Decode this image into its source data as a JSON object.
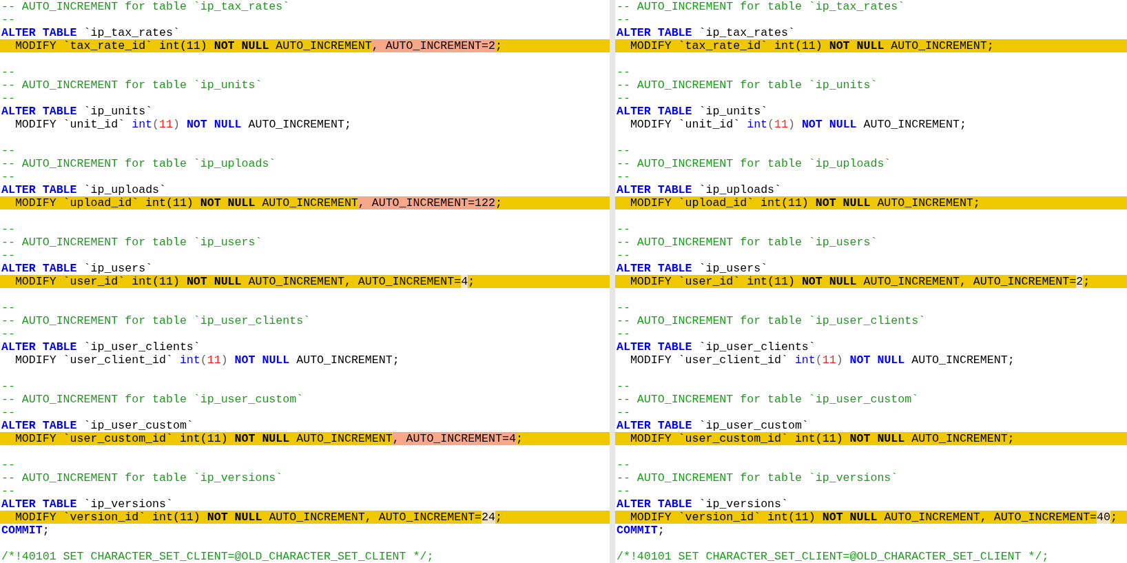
{
  "left": {
    "lines": [
      {
        "kind": "code",
        "changed": false,
        "segments": [
          {
            "kind": "comment",
            "text": "-- AUTO_INCREMENT for table `ip_tax_rates`"
          }
        ]
      },
      {
        "kind": "code",
        "changed": false,
        "segments": [
          {
            "kind": "comment",
            "text": "--"
          }
        ]
      },
      {
        "kind": "code",
        "changed": false,
        "segments": [
          {
            "kind": "keyword",
            "text": "ALTER TABLE"
          },
          {
            "kind": "plain",
            "text": " `ip_tax_rates`"
          }
        ]
      },
      {
        "kind": "code",
        "changed": true,
        "segments": [
          {
            "kind": "plain",
            "text": "  MODIFY `tax_rate_id` int(11) "
          },
          {
            "kind": "strong",
            "text": "NOT NULL"
          },
          {
            "kind": "plain",
            "text": " AUTO_INCREMENT"
          },
          {
            "kind": "plain",
            "text": ", AUTO_INCREMENT=2",
            "removed": true
          },
          {
            "kind": "plain",
            "text": ";"
          }
        ]
      },
      {
        "kind": "blank"
      },
      {
        "kind": "code",
        "changed": false,
        "segments": [
          {
            "kind": "comment",
            "text": "--"
          }
        ]
      },
      {
        "kind": "code",
        "changed": false,
        "segments": [
          {
            "kind": "comment",
            "text": "-- AUTO_INCREMENT for table `ip_units`"
          }
        ]
      },
      {
        "kind": "code",
        "changed": false,
        "segments": [
          {
            "kind": "comment",
            "text": "--"
          }
        ]
      },
      {
        "kind": "code",
        "changed": false,
        "segments": [
          {
            "kind": "keyword",
            "text": "ALTER TABLE"
          },
          {
            "kind": "plain",
            "text": " `ip_units`"
          }
        ]
      },
      {
        "kind": "code",
        "changed": false,
        "segments": [
          {
            "kind": "plain",
            "text": "  MODIFY `unit_id` "
          },
          {
            "kind": "type",
            "text": "int"
          },
          {
            "kind": "punct",
            "text": "("
          },
          {
            "kind": "number",
            "text": "11"
          },
          {
            "kind": "punct",
            "text": ") "
          },
          {
            "kind": "keyword",
            "text": "NOT NULL"
          },
          {
            "kind": "plain",
            "text": " AUTO_INCREMENT;"
          }
        ]
      },
      {
        "kind": "blank"
      },
      {
        "kind": "code",
        "changed": false,
        "segments": [
          {
            "kind": "comment",
            "text": "--"
          }
        ]
      },
      {
        "kind": "code",
        "changed": false,
        "segments": [
          {
            "kind": "comment",
            "text": "-- AUTO_INCREMENT for table `ip_uploads`"
          }
        ]
      },
      {
        "kind": "code",
        "changed": false,
        "segments": [
          {
            "kind": "comment",
            "text": "--"
          }
        ]
      },
      {
        "kind": "code",
        "changed": false,
        "segments": [
          {
            "kind": "keyword",
            "text": "ALTER TABLE"
          },
          {
            "kind": "plain",
            "text": " `ip_uploads`"
          }
        ]
      },
      {
        "kind": "code",
        "changed": true,
        "segments": [
          {
            "kind": "plain",
            "text": "  MODIFY `upload_id` int(11) "
          },
          {
            "kind": "strong",
            "text": "NOT NULL"
          },
          {
            "kind": "plain",
            "text": " AUTO_INCREMENT"
          },
          {
            "kind": "plain",
            "text": ", AUTO_INCREMENT=122",
            "removed": true
          },
          {
            "kind": "plain",
            "text": ";"
          }
        ]
      },
      {
        "kind": "blank"
      },
      {
        "kind": "code",
        "changed": false,
        "segments": [
          {
            "kind": "comment",
            "text": "--"
          }
        ]
      },
      {
        "kind": "code",
        "changed": false,
        "segments": [
          {
            "kind": "comment",
            "text": "-- AUTO_INCREMENT for table `ip_users`"
          }
        ]
      },
      {
        "kind": "code",
        "changed": false,
        "segments": [
          {
            "kind": "comment",
            "text": "--"
          }
        ]
      },
      {
        "kind": "code",
        "changed": false,
        "segments": [
          {
            "kind": "keyword",
            "text": "ALTER TABLE"
          },
          {
            "kind": "plain",
            "text": " `ip_users`"
          }
        ]
      },
      {
        "kind": "code",
        "changed": true,
        "segments": [
          {
            "kind": "plain",
            "text": "  MODIFY `user_id` int(11) "
          },
          {
            "kind": "strong",
            "text": "NOT NULL"
          },
          {
            "kind": "plain",
            "text": " AUTO_INCREMENT, AUTO_INCREMENT="
          },
          {
            "kind": "plain",
            "text": "4",
            "modified": true
          },
          {
            "kind": "plain",
            "text": ";"
          }
        ]
      },
      {
        "kind": "blank"
      },
      {
        "kind": "code",
        "changed": false,
        "segments": [
          {
            "kind": "comment",
            "text": "--"
          }
        ]
      },
      {
        "kind": "code",
        "changed": false,
        "segments": [
          {
            "kind": "comment",
            "text": "-- AUTO_INCREMENT for table `ip_user_clients`"
          }
        ]
      },
      {
        "kind": "code",
        "changed": false,
        "segments": [
          {
            "kind": "comment",
            "text": "--"
          }
        ]
      },
      {
        "kind": "code",
        "changed": false,
        "segments": [
          {
            "kind": "keyword",
            "text": "ALTER TABLE"
          },
          {
            "kind": "plain",
            "text": " `ip_user_clients`"
          }
        ]
      },
      {
        "kind": "code",
        "changed": false,
        "segments": [
          {
            "kind": "plain",
            "text": "  MODIFY `user_client_id` "
          },
          {
            "kind": "type",
            "text": "int"
          },
          {
            "kind": "punct",
            "text": "("
          },
          {
            "kind": "number",
            "text": "11"
          },
          {
            "kind": "punct",
            "text": ") "
          },
          {
            "kind": "keyword",
            "text": "NOT NULL"
          },
          {
            "kind": "plain",
            "text": " AUTO_INCREMENT;"
          }
        ]
      },
      {
        "kind": "blank"
      },
      {
        "kind": "code",
        "changed": false,
        "segments": [
          {
            "kind": "comment",
            "text": "--"
          }
        ]
      },
      {
        "kind": "code",
        "changed": false,
        "segments": [
          {
            "kind": "comment",
            "text": "-- AUTO_INCREMENT for table `ip_user_custom`"
          }
        ]
      },
      {
        "kind": "code",
        "changed": false,
        "segments": [
          {
            "kind": "comment",
            "text": "--"
          }
        ]
      },
      {
        "kind": "code",
        "changed": false,
        "segments": [
          {
            "kind": "keyword",
            "text": "ALTER TABLE"
          },
          {
            "kind": "plain",
            "text": " `ip_user_custom`"
          }
        ]
      },
      {
        "kind": "code",
        "changed": true,
        "segments": [
          {
            "kind": "plain",
            "text": "  MODIFY `user_custom_id` int(11) "
          },
          {
            "kind": "strong",
            "text": "NOT NULL"
          },
          {
            "kind": "plain",
            "text": " AUTO_INCREMENT"
          },
          {
            "kind": "plain",
            "text": ", AUTO_INCREMENT=4",
            "removed": true
          },
          {
            "kind": "plain",
            "text": ";"
          }
        ]
      },
      {
        "kind": "blank"
      },
      {
        "kind": "code",
        "changed": false,
        "segments": [
          {
            "kind": "comment",
            "text": "--"
          }
        ]
      },
      {
        "kind": "code",
        "changed": false,
        "segments": [
          {
            "kind": "comment",
            "text": "-- AUTO_INCREMENT for table `ip_versions`"
          }
        ]
      },
      {
        "kind": "code",
        "changed": false,
        "segments": [
          {
            "kind": "comment",
            "text": "--"
          }
        ]
      },
      {
        "kind": "code",
        "changed": false,
        "segments": [
          {
            "kind": "keyword",
            "text": "ALTER TABLE"
          },
          {
            "kind": "plain",
            "text": " `ip_versions`"
          }
        ]
      },
      {
        "kind": "code",
        "changed": true,
        "segments": [
          {
            "kind": "plain",
            "text": "  MODIFY `version_id` int(11) "
          },
          {
            "kind": "strong",
            "text": "NOT NULL"
          },
          {
            "kind": "plain",
            "text": " AUTO_INCREMENT, AUTO_INCREMENT="
          },
          {
            "kind": "plain",
            "text": "24",
            "modified": true
          },
          {
            "kind": "plain",
            "text": ";"
          }
        ]
      },
      {
        "kind": "code",
        "changed": false,
        "segments": [
          {
            "kind": "keyword",
            "text": "COMMIT"
          },
          {
            "kind": "plain",
            "text": ";"
          }
        ]
      },
      {
        "kind": "blank"
      },
      {
        "kind": "code",
        "changed": false,
        "segments": [
          {
            "kind": "comment",
            "text": "/*!40101 SET CHARACTER_SET_CLIENT=@OLD_CHARACTER_SET_CLIENT */;"
          }
        ]
      }
    ]
  },
  "right": {
    "lines": [
      {
        "kind": "code",
        "changed": false,
        "segments": [
          {
            "kind": "comment",
            "text": "-- AUTO_INCREMENT for table `ip_tax_rates`"
          }
        ]
      },
      {
        "kind": "code",
        "changed": false,
        "segments": [
          {
            "kind": "comment",
            "text": "--"
          }
        ]
      },
      {
        "kind": "code",
        "changed": false,
        "segments": [
          {
            "kind": "keyword",
            "text": "ALTER TABLE"
          },
          {
            "kind": "plain",
            "text": " `ip_tax_rates`"
          }
        ]
      },
      {
        "kind": "code",
        "changed": true,
        "segments": [
          {
            "kind": "plain",
            "text": "  MODIFY `tax_rate_id` int(11) "
          },
          {
            "kind": "strong",
            "text": "NOT NULL"
          },
          {
            "kind": "plain",
            "text": " AUTO_INCREMENT;"
          }
        ]
      },
      {
        "kind": "blank"
      },
      {
        "kind": "code",
        "changed": false,
        "segments": [
          {
            "kind": "comment",
            "text": "--"
          }
        ]
      },
      {
        "kind": "code",
        "changed": false,
        "segments": [
          {
            "kind": "comment",
            "text": "-- AUTO_INCREMENT for table `ip_units`"
          }
        ]
      },
      {
        "kind": "code",
        "changed": false,
        "segments": [
          {
            "kind": "comment",
            "text": "--"
          }
        ]
      },
      {
        "kind": "code",
        "changed": false,
        "segments": [
          {
            "kind": "keyword",
            "text": "ALTER TABLE"
          },
          {
            "kind": "plain",
            "text": " `ip_units`"
          }
        ]
      },
      {
        "kind": "code",
        "changed": false,
        "segments": [
          {
            "kind": "plain",
            "text": "  MODIFY `unit_id` "
          },
          {
            "kind": "type",
            "text": "int"
          },
          {
            "kind": "punct",
            "text": "("
          },
          {
            "kind": "number",
            "text": "11"
          },
          {
            "kind": "punct",
            "text": ") "
          },
          {
            "kind": "keyword",
            "text": "NOT NULL"
          },
          {
            "kind": "plain",
            "text": " AUTO_INCREMENT;"
          }
        ]
      },
      {
        "kind": "blank"
      },
      {
        "kind": "code",
        "changed": false,
        "segments": [
          {
            "kind": "comment",
            "text": "--"
          }
        ]
      },
      {
        "kind": "code",
        "changed": false,
        "segments": [
          {
            "kind": "comment",
            "text": "-- AUTO_INCREMENT for table `ip_uploads`"
          }
        ]
      },
      {
        "kind": "code",
        "changed": false,
        "segments": [
          {
            "kind": "comment",
            "text": "--"
          }
        ]
      },
      {
        "kind": "code",
        "changed": false,
        "segments": [
          {
            "kind": "keyword",
            "text": "ALTER TABLE"
          },
          {
            "kind": "plain",
            "text": " `ip_uploads`"
          }
        ]
      },
      {
        "kind": "code",
        "changed": true,
        "segments": [
          {
            "kind": "plain",
            "text": "  MODIFY `upload_id` int(11) "
          },
          {
            "kind": "strong",
            "text": "NOT NULL"
          },
          {
            "kind": "plain",
            "text": " AUTO_INCREMENT;"
          }
        ]
      },
      {
        "kind": "blank"
      },
      {
        "kind": "code",
        "changed": false,
        "segments": [
          {
            "kind": "comment",
            "text": "--"
          }
        ]
      },
      {
        "kind": "code",
        "changed": false,
        "segments": [
          {
            "kind": "comment",
            "text": "-- AUTO_INCREMENT for table `ip_users`"
          }
        ]
      },
      {
        "kind": "code",
        "changed": false,
        "segments": [
          {
            "kind": "comment",
            "text": "--"
          }
        ]
      },
      {
        "kind": "code",
        "changed": false,
        "segments": [
          {
            "kind": "keyword",
            "text": "ALTER TABLE"
          },
          {
            "kind": "plain",
            "text": " `ip_users`"
          }
        ]
      },
      {
        "kind": "code",
        "changed": true,
        "segments": [
          {
            "kind": "plain",
            "text": "  MODIFY `user_id` int(11) "
          },
          {
            "kind": "strong",
            "text": "NOT NULL"
          },
          {
            "kind": "plain",
            "text": " AUTO_INCREMENT, AUTO_INCREMENT="
          },
          {
            "kind": "plain",
            "text": "2",
            "modified": true
          },
          {
            "kind": "plain",
            "text": ";"
          }
        ]
      },
      {
        "kind": "blank"
      },
      {
        "kind": "code",
        "changed": false,
        "segments": [
          {
            "kind": "comment",
            "text": "--"
          }
        ]
      },
      {
        "kind": "code",
        "changed": false,
        "segments": [
          {
            "kind": "comment",
            "text": "-- AUTO_INCREMENT for table `ip_user_clients`"
          }
        ]
      },
      {
        "kind": "code",
        "changed": false,
        "segments": [
          {
            "kind": "comment",
            "text": "--"
          }
        ]
      },
      {
        "kind": "code",
        "changed": false,
        "segments": [
          {
            "kind": "keyword",
            "text": "ALTER TABLE"
          },
          {
            "kind": "plain",
            "text": " `ip_user_clients`"
          }
        ]
      },
      {
        "kind": "code",
        "changed": false,
        "segments": [
          {
            "kind": "plain",
            "text": "  MODIFY `user_client_id` "
          },
          {
            "kind": "type",
            "text": "int"
          },
          {
            "kind": "punct",
            "text": "("
          },
          {
            "kind": "number",
            "text": "11"
          },
          {
            "kind": "punct",
            "text": ") "
          },
          {
            "kind": "keyword",
            "text": "NOT NULL"
          },
          {
            "kind": "plain",
            "text": " AUTO_INCREMENT;"
          }
        ]
      },
      {
        "kind": "blank"
      },
      {
        "kind": "code",
        "changed": false,
        "segments": [
          {
            "kind": "comment",
            "text": "--"
          }
        ]
      },
      {
        "kind": "code",
        "changed": false,
        "segments": [
          {
            "kind": "comment",
            "text": "-- AUTO_INCREMENT for table `ip_user_custom`"
          }
        ]
      },
      {
        "kind": "code",
        "changed": false,
        "segments": [
          {
            "kind": "comment",
            "text": "--"
          }
        ]
      },
      {
        "kind": "code",
        "changed": false,
        "segments": [
          {
            "kind": "keyword",
            "text": "ALTER TABLE"
          },
          {
            "kind": "plain",
            "text": " `ip_user_custom`"
          }
        ]
      },
      {
        "kind": "code",
        "changed": true,
        "segments": [
          {
            "kind": "plain",
            "text": "  MODIFY `user_custom_id` int(11) "
          },
          {
            "kind": "strong",
            "text": "NOT NULL"
          },
          {
            "kind": "plain",
            "text": " AUTO_INCREMENT;"
          }
        ]
      },
      {
        "kind": "blank"
      },
      {
        "kind": "code",
        "changed": false,
        "segments": [
          {
            "kind": "comment",
            "text": "--"
          }
        ]
      },
      {
        "kind": "code",
        "changed": false,
        "segments": [
          {
            "kind": "comment",
            "text": "-- AUTO_INCREMENT for table `ip_versions`"
          }
        ]
      },
      {
        "kind": "code",
        "changed": false,
        "segments": [
          {
            "kind": "comment",
            "text": "--"
          }
        ]
      },
      {
        "kind": "code",
        "changed": false,
        "segments": [
          {
            "kind": "keyword",
            "text": "ALTER TABLE"
          },
          {
            "kind": "plain",
            "text": " `ip_versions`"
          }
        ]
      },
      {
        "kind": "code",
        "changed": true,
        "segments": [
          {
            "kind": "plain",
            "text": "  MODIFY `version_id` int(11) "
          },
          {
            "kind": "strong",
            "text": "NOT NULL"
          },
          {
            "kind": "plain",
            "text": " AUTO_INCREMENT, AUTO_INCREMENT="
          },
          {
            "kind": "plain",
            "text": "40",
            "modified": true
          },
          {
            "kind": "plain",
            "text": ";"
          }
        ]
      },
      {
        "kind": "code",
        "changed": false,
        "segments": [
          {
            "kind": "keyword",
            "text": "COMMIT"
          },
          {
            "kind": "plain",
            "text": ";"
          }
        ]
      },
      {
        "kind": "blank"
      },
      {
        "kind": "code",
        "changed": false,
        "segments": [
          {
            "kind": "comment",
            "text": "/*!40101 SET CHARACTER_SET_CLIENT=@OLD_CHARACTER_SET_CLIENT */;"
          }
        ]
      }
    ]
  }
}
